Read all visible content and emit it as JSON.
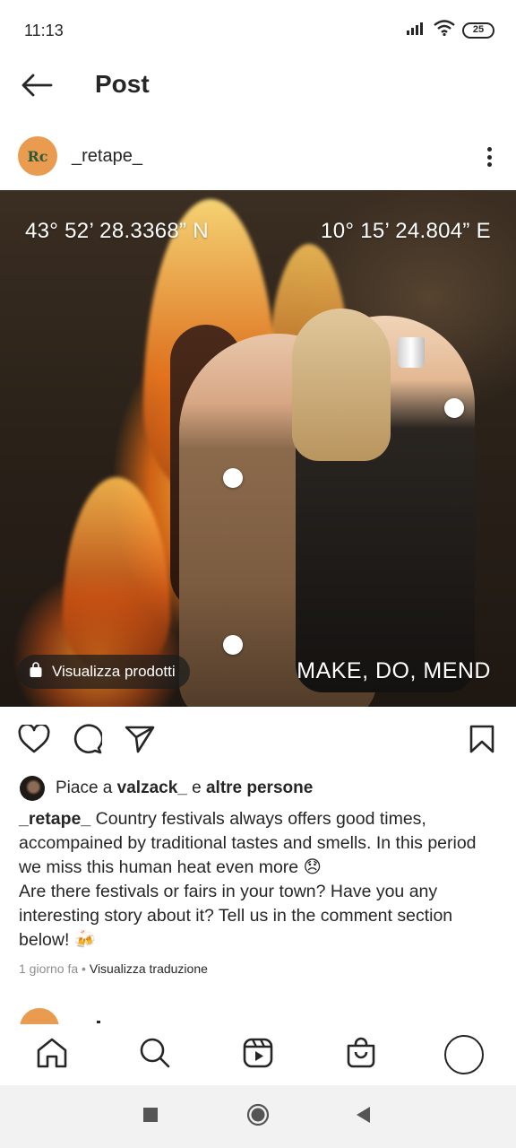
{
  "status_bar": {
    "time": "11:13",
    "battery": "25",
    "icons": [
      "signal-icon",
      "wifi-icon",
      "battery-icon"
    ]
  },
  "header": {
    "title": "Post",
    "back_icon": "arrow-left-icon"
  },
  "post": {
    "author": {
      "username": "_retape_",
      "avatar_text": "Rc",
      "avatar_color": "#e99c4f"
    },
    "photo": {
      "coord_left": "43° 52’ 28.3368” N",
      "coord_right": "10° 15’ 24.804” E",
      "caption_overlay": "MAKE, DO, MEND",
      "shop_button": "Visualizza prodotti"
    },
    "likes": {
      "prefix": "Piace a ",
      "user": "valzack_",
      "middle": " e ",
      "others": "altre persone"
    },
    "caption": {
      "username": "_retape_",
      "text": " Country festivals always offers good times, accompained by traditional tastes and smells. In this period we miss this human heat even more 😞",
      "text2": "Are there festivals or fairs in your town? Have you any interesting story about it? Tell us in the comment section below! 🍻"
    },
    "meta": {
      "time": "1 giorno fa",
      "separator": " • ",
      "translate": "Visualizza traduzione"
    }
  },
  "bottom_nav": {
    "items": [
      "home-icon",
      "search-icon",
      "reels-icon",
      "shop-icon",
      "profile-avatar"
    ]
  },
  "system_nav": {
    "items": [
      "recents-button",
      "home-button",
      "back-button"
    ]
  },
  "colors": {
    "text": "#262626",
    "muted": "#8e8e8e",
    "accent": "#e99c4f"
  }
}
